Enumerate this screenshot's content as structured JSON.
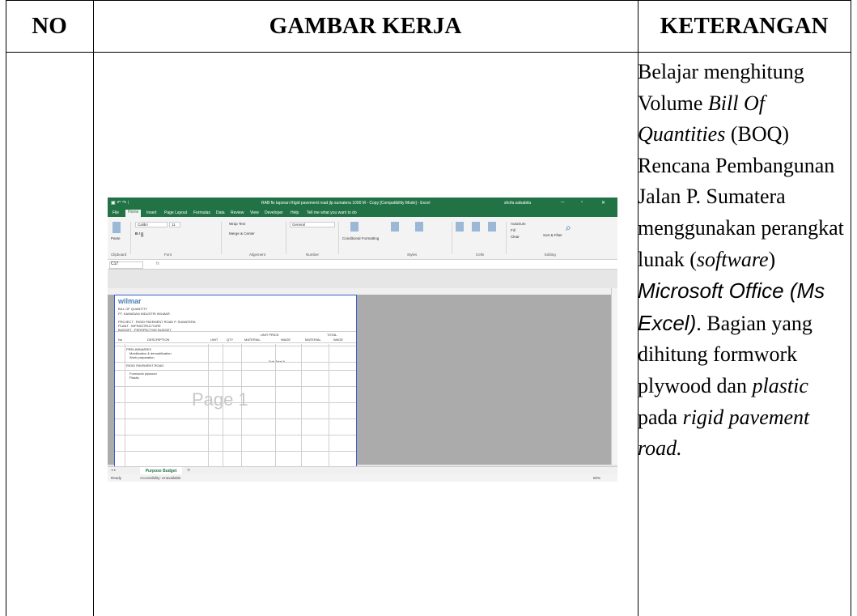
{
  "table": {
    "headers": {
      "no": "NO",
      "gambar": "GAMBAR KERJA",
      "keterangan": "KETERANGAN"
    }
  },
  "description": {
    "p1": "Belajar menghitung Volume ",
    "p2": "Bill Of Quantities",
    "p3": " (BOQ) Rencana Pembangunan Jalan P. Sumatera menggunakan perangkat lunak (",
    "p4": "software",
    "p5": ") ",
    "p6": "Microsoft Office (Ms Excel)",
    "p7": ". Bagian yang dihitung formwork plywood dan ",
    "p8": "plastic",
    "p9": " pada ",
    "p10": "rigid pavement road."
  },
  "excel": {
    "window_title": "RAB fix laporan Rigid pavement road jlp sumatera 1000 M - Copy  [Compatibility Mode]  -  Excel",
    "user": "shofa salsabila",
    "menu": [
      "File",
      "Home",
      "Insert",
      "Page Layout",
      "Formulas",
      "Data",
      "Review",
      "View",
      "Developer",
      "Help",
      "Tell me what you want to do"
    ],
    "font_name": "Calibri",
    "font_size": "11",
    "wrap_text": "Wrap Text",
    "merge_center": "Merge & Center",
    "number_format": "General",
    "ribbon_groups": [
      "Clipboard",
      "Font",
      "Alignment",
      "Number",
      "Styles",
      "Cells",
      "Editing"
    ],
    "ribbon_buttons": [
      "Paste",
      "Conditional Formatting",
      "Format as Table",
      "Cell Styles",
      "Insert",
      "Delete",
      "Format",
      "AutoSum",
      "Fill",
      "Clear",
      "Sort & Filter",
      "Find & Select"
    ],
    "name_box": "C17",
    "fx": "fx",
    "sheet": {
      "company": "wilmar",
      "title": "BILL OF QUANTITY",
      "subtitle": "PT. KAWASAN INDUSTRI WILMAR",
      "project": "PROJECT : RIGID PAVEMENT ROAD P. SUMATERA",
      "plant": "PLANT : INFRASTRUCTURE",
      "budget": "BUDGET : PERSPECTIVE BUDGET",
      "watermark": "Page 1",
      "headers": [
        "No",
        "DESCRIPTION",
        "UNIT",
        "QTY",
        "UNIT PRICE",
        "MATERIAL",
        "WAGE",
        "TOTAL",
        "MATERIAL",
        "WAGE"
      ],
      "rows": [
        "PRELIMINARIES",
        "Mobilization & demobilization",
        "Work preparation",
        "RIGID PAVEMENT ROAD",
        "Formwork plywood",
        "Plastic",
        "Sub Total A"
      ]
    },
    "sheet_tab": "Purpose Budget",
    "status_ready": "Ready",
    "accessibility": "Accessibility: Unavailable",
    "zoom": "60%"
  }
}
